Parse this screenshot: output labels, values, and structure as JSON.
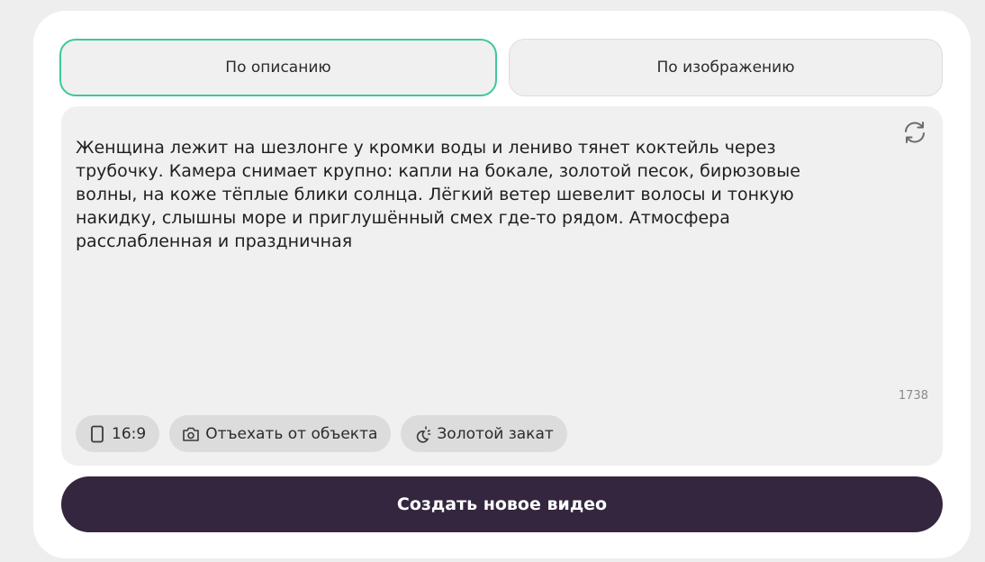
{
  "tabs": [
    {
      "label": "По описанию",
      "active": true
    },
    {
      "label": "По изображению",
      "active": false
    }
  ],
  "prompt": {
    "text": "Женщина лежит на шезлонге у кромки воды и лениво тянет коктейль через трубочку. Камера снимает крупно: капли на бокале, золотой песок, бирюзовые волны, на коже тёплые блики солнца. Лёгкий ветер шевелит волосы и тонкую накидку, слышны море и приглушённый смех где-то рядом. Атмосфера расслабленная и праздничная",
    "char_count": "1738"
  },
  "chips": [
    {
      "icon": "phone-portrait-icon",
      "label": "16:9"
    },
    {
      "icon": "camera-rotate-icon",
      "label": "Отъехать от объекта"
    },
    {
      "icon": "sunset-icon",
      "label": "Золотой закат"
    }
  ],
  "create_button": {
    "label": "Создать новое видео"
  },
  "colors": {
    "accent": "#3ec79c",
    "button_bg": "#33263e",
    "panel_bg": "#f0f0f0",
    "chip_bg": "#dcdcdc"
  }
}
